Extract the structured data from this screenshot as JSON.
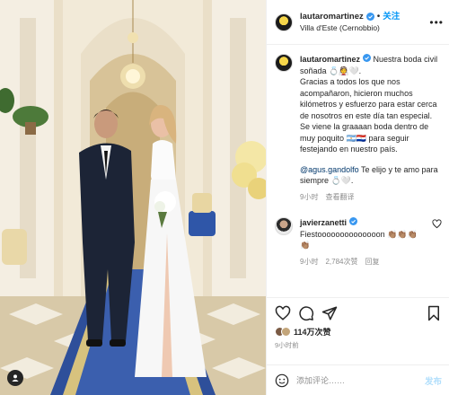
{
  "header": {
    "username": "lautaromartinez",
    "follow_label": "关注",
    "location": "Villa d'Este (Cernobbio)",
    "more_label": "•••"
  },
  "caption": {
    "username": "lautaromartinez",
    "lines": [
      " Nuestra boda civil soñada 💍👰🤍.",
      "Gracias a todos los que nos acompañaron, hicieron muchos kilómetros y esfuerzo para estar cerca de nosotros en este día tan especial.",
      "Se viene la graaaan boda dentro de muy poquito 🇦🇷🇵🇾 para seguir festejando en nuestro país.",
      "",
      "@agus.gandolfo",
      " Te elijo y te amo para siempre 💍🤍."
    ],
    "time": "9小时",
    "translate_label": "查看翻译"
  },
  "comment2": {
    "username": "javierzanetti",
    "text": "Fiestoooooooooooooon 👏🏽👏🏽👏🏽👏🏽",
    "time": "9小时",
    "likes": "2,784次赞",
    "reply_label": "回复"
  },
  "actions": {
    "likes_text": "114万次赞",
    "time_ago": "9小时前"
  },
  "add_comment": {
    "placeholder": "添加评论……",
    "post_label": "发布"
  },
  "colors": {
    "accent": "#0095f6",
    "verified": "#3897f0",
    "muted": "#8e8e8e",
    "link": "#00376b"
  }
}
